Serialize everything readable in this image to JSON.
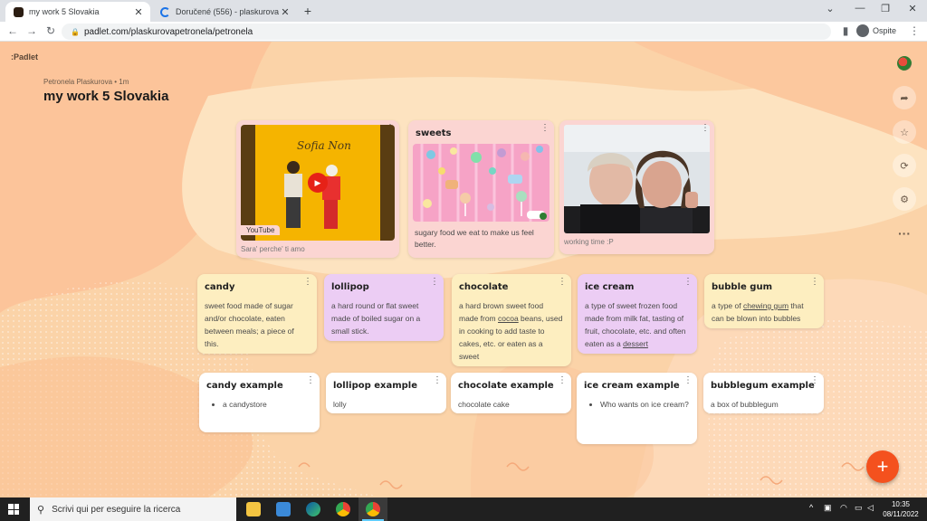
{
  "browser": {
    "tabs": [
      {
        "title": "my work 5 Slovakia",
        "close": "✕"
      },
      {
        "title": "Doručené (556) - plaskurova.pet…",
        "close": "✕"
      }
    ],
    "new_tab": "+",
    "url": "padlet.com/plaskurovapetronela/petronela",
    "profile_label": "Ospite"
  },
  "padlet": {
    "brand": ":Padlet",
    "author": "Petronela Plaskurova • 1m",
    "title": "my work 5 Slovakia",
    "top_cards": [
      {
        "badge": "YouTube",
        "poster_text": "Sofia Non",
        "caption": "Sara' perche' ti amo"
      },
      {
        "title": "sweets",
        "body": "sugary food we eat to make us feel better."
      },
      {
        "caption": "working time :P"
      }
    ],
    "row1": [
      {
        "title": "candy",
        "body": "sweet food made of sugar and/or chocolate, eaten between meals; a piece of this."
      },
      {
        "title": "lollipop",
        "body": "a hard round or flat sweet made of boiled sugar on a small stick."
      },
      {
        "title": "chocolate",
        "body_a": "a hard brown sweet food made from ",
        "link": "cocoa",
        "body_b": " beans, used in cooking to add taste to cakes, etc. or eaten as a sweet"
      },
      {
        "title": "ice cream",
        "body_a": "a type of sweet frozen food made from milk fat, tasting of fruit, chocolate, etc. and often eaten as a ",
        "link": "dessert",
        "body_b": ""
      },
      {
        "title": "bubble gum",
        "body_a": "a type of ",
        "link": "chewing gum",
        "body_b": " that can be blown into bubbles"
      }
    ],
    "row2": [
      {
        "title": "candy example",
        "bullet": "a candystore"
      },
      {
        "title": "lollipop example",
        "body": "lolly"
      },
      {
        "title": "chocolate example",
        "body": "chocolate cake"
      },
      {
        "title": "ice cream example",
        "bullet": "Who wants on ice cream?"
      },
      {
        "title": "bubblegum example",
        "body": "a box of bubblegum"
      }
    ],
    "fab": "+"
  },
  "taskbar": {
    "search_placeholder": "Scrivi qui per eseguire la ricerca",
    "time": "10:35",
    "date": "08/11/2022"
  },
  "colors": {
    "page_bg": "#fbd3a8",
    "fab": "#f4511e",
    "card_pink": "#fbd5d2",
    "card_yellow": "#fdeec0",
    "card_lilac": "#eccdf4"
  }
}
